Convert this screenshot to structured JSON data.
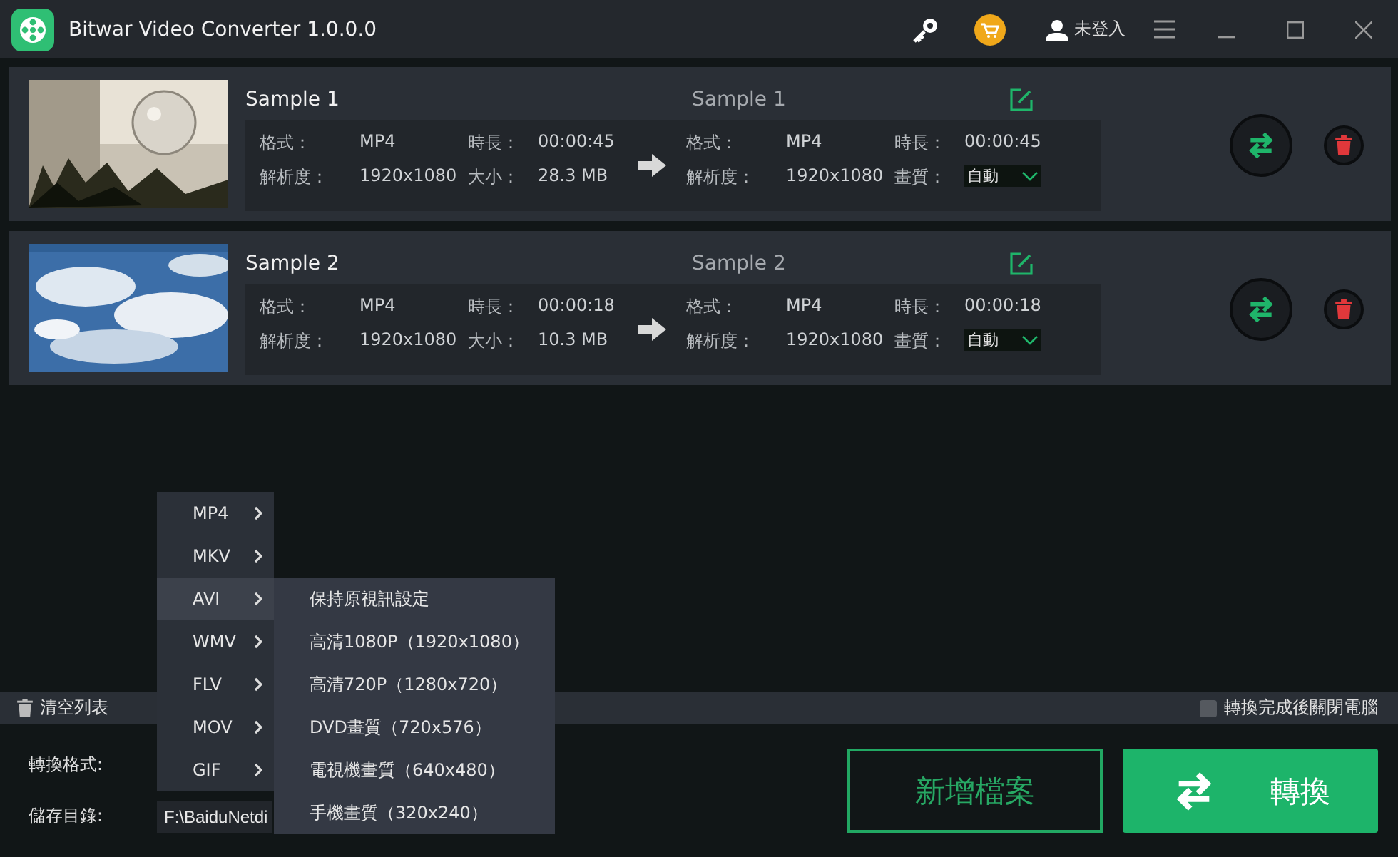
{
  "window": {
    "title": "Bitwar Video Converter  1.0.0.0"
  },
  "header": {
    "user": "未登入"
  },
  "files": [
    {
      "name": "Sample 1",
      "output_name": "Sample 1",
      "source": [
        {
          "label": "格式：",
          "value": "MP4"
        },
        {
          "label": "時長：",
          "value": "00:00:45"
        },
        {
          "label": "解析度：",
          "value": "1920x1080"
        },
        {
          "label": "大小：",
          "value": "28.3 MB"
        }
      ],
      "target": [
        {
          "label": "格式：",
          "value": "MP4"
        },
        {
          "label": "時長：",
          "value": "00:00:45"
        },
        {
          "label": "解析度：",
          "value": "1920x1080"
        },
        {
          "label": "畫質：",
          "value": "自動",
          "kind": "dropdown"
        }
      ]
    },
    {
      "name": "Sample 2",
      "output_name": "Sample 2",
      "source": [
        {
          "label": "格式：",
          "value": "MP4"
        },
        {
          "label": "時長：",
          "value": "00:00:18"
        },
        {
          "label": "解析度：",
          "value": "1920x1080"
        },
        {
          "label": "大小：",
          "value": "10.3 MB"
        }
      ],
      "target": [
        {
          "label": "格式：",
          "value": "MP4"
        },
        {
          "label": "時長：",
          "value": "00:00:18"
        },
        {
          "label": "解析度：",
          "value": "1920x1080"
        },
        {
          "label": "畫質：",
          "value": "自動",
          "kind": "dropdown"
        }
      ]
    }
  ],
  "toolbar": {
    "clear": "清空列表",
    "shutdown": {
      "label": "轉換完成後關閉電腦",
      "checked": false
    }
  },
  "bottom": {
    "format_label": "轉換格式:",
    "save_label": "儲存目錄:",
    "path": "F:\\BaiduNetdi",
    "add_button": "新增檔案",
    "convert_button": "轉換"
  },
  "format_menu": [
    {
      "label": "MP4",
      "selected": false
    },
    {
      "label": "MKV",
      "selected": false
    },
    {
      "label": "AVI",
      "selected": true
    },
    {
      "label": "WMV",
      "selected": false
    },
    {
      "label": "FLV",
      "selected": false
    },
    {
      "label": "MOV",
      "selected": false
    },
    {
      "label": "GIF",
      "selected": false
    }
  ],
  "submenu": [
    "保持原視訊設定",
    "高清1080P（1920x1080）",
    "高清720P（1280x720）",
    "DVD畫質（720x576）",
    "電視機畫質（640x480）",
    "手機畫質（320x240）"
  ]
}
